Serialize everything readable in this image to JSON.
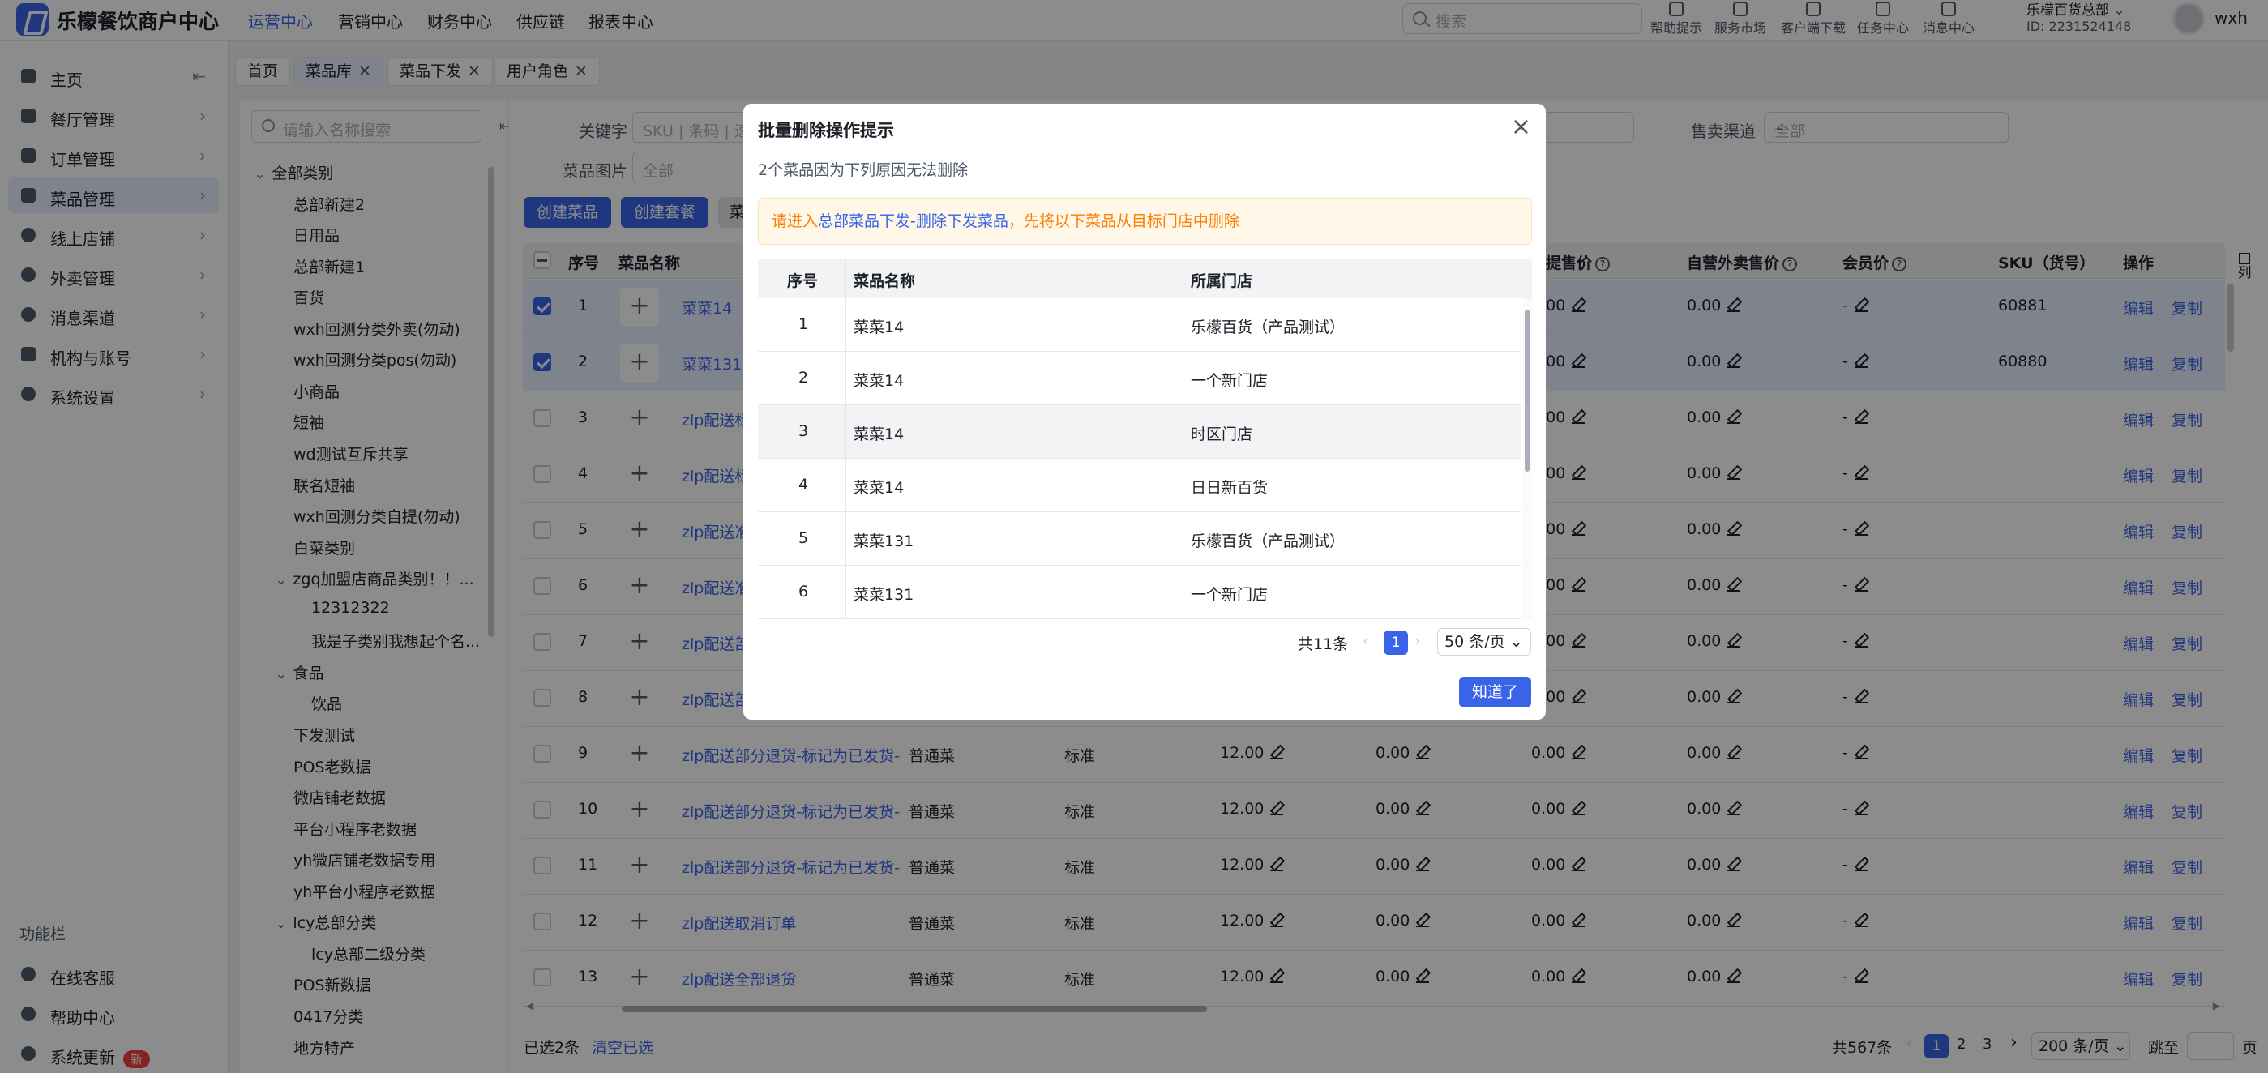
{
  "app": {
    "name": "乐檬餐饮商户中心"
  },
  "top_nav": [
    "运营中心",
    "营销中心",
    "财务中心",
    "供应链",
    "报表中心"
  ],
  "search": {
    "placeholder": "搜索"
  },
  "top_icons": [
    "帮助提示",
    "服务市场",
    "客户端下载",
    "任务中心",
    "消息中心"
  ],
  "tenant": {
    "name": "乐檬百货总部",
    "id": "ID: 2231524148"
  },
  "user": {
    "name": "wxh"
  },
  "sidebar": {
    "items": [
      "主页",
      "餐厅管理",
      "订单管理",
      "菜品管理",
      "线上店铺",
      "外卖管理",
      "消息渠道",
      "机构与账号",
      "系统设置"
    ],
    "section_title": "功能栏",
    "bottom_items": [
      "在线客服",
      "帮助中心",
      "系统更新"
    ],
    "update_badge": "新"
  },
  "tabs": [
    "首页",
    "菜品库",
    "菜品下发",
    "用户角色"
  ],
  "category_panel": {
    "search_placeholder": "请输入名称搜索",
    "items": [
      "全部类别",
      "总部新建2",
      "日用品",
      "总部新建1",
      "百货",
      "wxh回测分类外卖(勿动)",
      "wxh回测分类pos(勿动)",
      "小商品",
      "短袖",
      "wd测试互斥共享",
      "联名短袖",
      "wxh回测分类自提(勿动)",
      "白菜类别",
      "zgq加盟店商品类别！！...",
      "12312322",
      "我是子类别我想起个名...",
      "食品",
      "饮品",
      "下发测试",
      "POS老数据",
      "微店铺老数据",
      "平台小程序老数据",
      "yh微店铺老数据专用",
      "yh平台小程序老数据",
      "lcy总部分类",
      "lcy总部二级分类",
      "POS新数据",
      "0417分类",
      "地方特产"
    ]
  },
  "filters": {
    "keyword_label": "关键字",
    "keyword_placeholder": "SKU | 条码 | 速",
    "channel_label": "售卖渠道",
    "channel_value": "全部",
    "image_label": "菜品图片",
    "image_value": "全部"
  },
  "buttons": {
    "create_dish": "创建菜品",
    "create_combo": "创建套餐",
    "third": "菜"
  },
  "table": {
    "headers": [
      "序号",
      "菜品名称",
      "提售价",
      "自营外卖售价",
      "会员价",
      "SKU（货号）",
      "操作"
    ],
    "column_setting": "列",
    "rows": [
      {
        "no": "1",
        "name": "菜菜14",
        "type": "",
        "spec": "",
        "price": "",
        "takeaway": "0.00",
        "self_takeaway": "0.00",
        "member": "-",
        "sku": "60881",
        "selected": true
      },
      {
        "no": "2",
        "name": "菜菜131",
        "type": "",
        "spec": "",
        "price": "",
        "takeaway": "0.00",
        "self_takeaway": "0.00",
        "member": "-",
        "sku": "60880",
        "selected": true
      },
      {
        "no": "3",
        "name": "zlp配送标",
        "type": "",
        "spec": "",
        "price": "",
        "takeaway": "0.00",
        "self_takeaway": "0.00",
        "member": "-",
        "sku": "",
        "selected": false
      },
      {
        "no": "4",
        "name": "zlp配送标",
        "type": "",
        "spec": "",
        "price": "",
        "takeaway": "0.00",
        "self_takeaway": "0.00",
        "member": "-",
        "sku": "",
        "selected": false
      },
      {
        "no": "5",
        "name": "zlp配送准",
        "type": "",
        "spec": "",
        "price": "",
        "takeaway": "0.00",
        "self_takeaway": "0.00",
        "member": "-",
        "sku": "",
        "selected": false
      },
      {
        "no": "6",
        "name": "zlp配送准",
        "type": "",
        "spec": "",
        "price": "",
        "takeaway": "0.00",
        "self_takeaway": "0.00",
        "member": "-",
        "sku": "",
        "selected": false
      },
      {
        "no": "7",
        "name": "zlp配送部",
        "type": "",
        "spec": "",
        "price": "",
        "takeaway": "0.00",
        "self_takeaway": "0.00",
        "member": "-",
        "sku": "",
        "selected": false
      },
      {
        "no": "8",
        "name": "zlp配送部",
        "type": "",
        "spec": "",
        "price": "",
        "takeaway": "0.00",
        "self_takeaway": "0.00",
        "member": "-",
        "sku": "",
        "selected": false
      },
      {
        "no": "9",
        "name": "zlp配送部分退货-标记为已发货-",
        "type": "普通菜",
        "spec": "标准",
        "price": "12.00",
        "takeaway": "0.00",
        "self_takeaway": "0.00",
        "member": "-",
        "sku": "",
        "selected": false,
        "extra": "0.00"
      },
      {
        "no": "10",
        "name": "zlp配送部分退货-标记为已发货-",
        "type": "普通菜",
        "spec": "标准",
        "price": "12.00",
        "takeaway": "0.00",
        "self_takeaway": "0.00",
        "member": "-",
        "sku": "",
        "selected": false,
        "extra": "0.00"
      },
      {
        "no": "11",
        "name": "zlp配送部分退货-标记为已发货-",
        "type": "普通菜",
        "spec": "标准",
        "price": "12.00",
        "takeaway": "0.00",
        "self_takeaway": "0.00",
        "member": "-",
        "sku": "",
        "selected": false,
        "extra": "0.00"
      },
      {
        "no": "12",
        "name": "zlp配送取消订单",
        "type": "普通菜",
        "spec": "标准",
        "price": "12.00",
        "takeaway": "0.00",
        "self_takeaway": "0.00",
        "member": "-",
        "sku": "",
        "selected": false,
        "extra": "0.00"
      },
      {
        "no": "13",
        "name": "zlp配送全部退货",
        "type": "普通菜",
        "spec": "标准",
        "price": "12.00",
        "takeaway": "0.00",
        "self_takeaway": "0.00",
        "member": "-",
        "sku": "",
        "selected": false,
        "extra": "0.00"
      }
    ],
    "row_actions": [
      "编辑",
      "复制"
    ]
  },
  "footer": {
    "selected_text": "已选2条",
    "clear_text": "清空已选",
    "total_text": "共567条",
    "pages": [
      "1",
      "2",
      "3"
    ],
    "page_size": "200 条/页",
    "jump_label": "跳至",
    "page_suffix": "页"
  },
  "modal": {
    "title": "批量删除操作提示",
    "subtitle": "2个菜品因为下列原因无法删除",
    "warning_prefix": "请进入",
    "warning_link": "总部菜品下发-删除下发菜品",
    "warning_suffix": "，先将以下菜品从目标门店中删除",
    "columns": [
      "序号",
      "菜品名称",
      "所属门店"
    ],
    "rows": [
      {
        "no": "1",
        "dish": "菜菜14",
        "store": "乐檬百货（产品测试）"
      },
      {
        "no": "2",
        "dish": "菜菜14",
        "store": "一个新门店"
      },
      {
        "no": "3",
        "dish": "菜菜14",
        "store": "时区门店"
      },
      {
        "no": "4",
        "dish": "菜菜14",
        "store": "日日新百货"
      },
      {
        "no": "5",
        "dish": "菜菜131",
        "store": "乐檬百货（产品测试）"
      },
      {
        "no": "6",
        "dish": "菜菜131",
        "store": "一个新门店"
      }
    ],
    "total": "共11条",
    "page": "1",
    "page_size": "50 条/页",
    "ok": "知道了"
  }
}
